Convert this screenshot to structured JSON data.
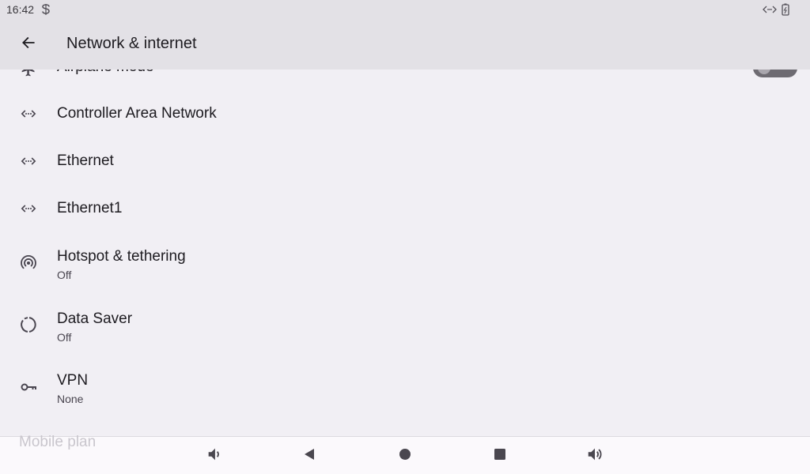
{
  "status_bar": {
    "time": "16:42",
    "icons": [
      "sync-icon",
      "network-arrows-icon",
      "battery-charging-icon"
    ]
  },
  "app_bar": {
    "title": "Network & internet",
    "back_icon": "arrow-back-icon"
  },
  "items": [
    {
      "title": "Airplane mode",
      "icon": "airplane-icon",
      "toggle": false
    },
    {
      "title": "Controller Area Network",
      "icon": "ethernet-icon"
    },
    {
      "title": "Ethernet",
      "icon": "ethernet-icon"
    },
    {
      "title": "Ethernet1",
      "icon": "ethernet-icon"
    },
    {
      "title": "Hotspot & tethering",
      "subtitle": "Off",
      "icon": "hotspot-icon"
    },
    {
      "title": "Data Saver",
      "subtitle": "Off",
      "icon": "data-saver-icon"
    },
    {
      "title": "VPN",
      "subtitle": "None",
      "icon": "vpn-key-icon"
    },
    {
      "title": "Mobile plan",
      "icon": ""
    }
  ],
  "nav_bar": {
    "buttons": [
      "volume-down-icon",
      "back-triangle-icon",
      "home-circle-icon",
      "recents-square-icon",
      "volume-up-icon"
    ]
  },
  "colors": {
    "background": "#f1eff4",
    "app_bar": "#e3e1e6",
    "nav_bar": "#fbf9fc",
    "text_primary": "#1d1b20",
    "text_secondary": "#49454f"
  }
}
